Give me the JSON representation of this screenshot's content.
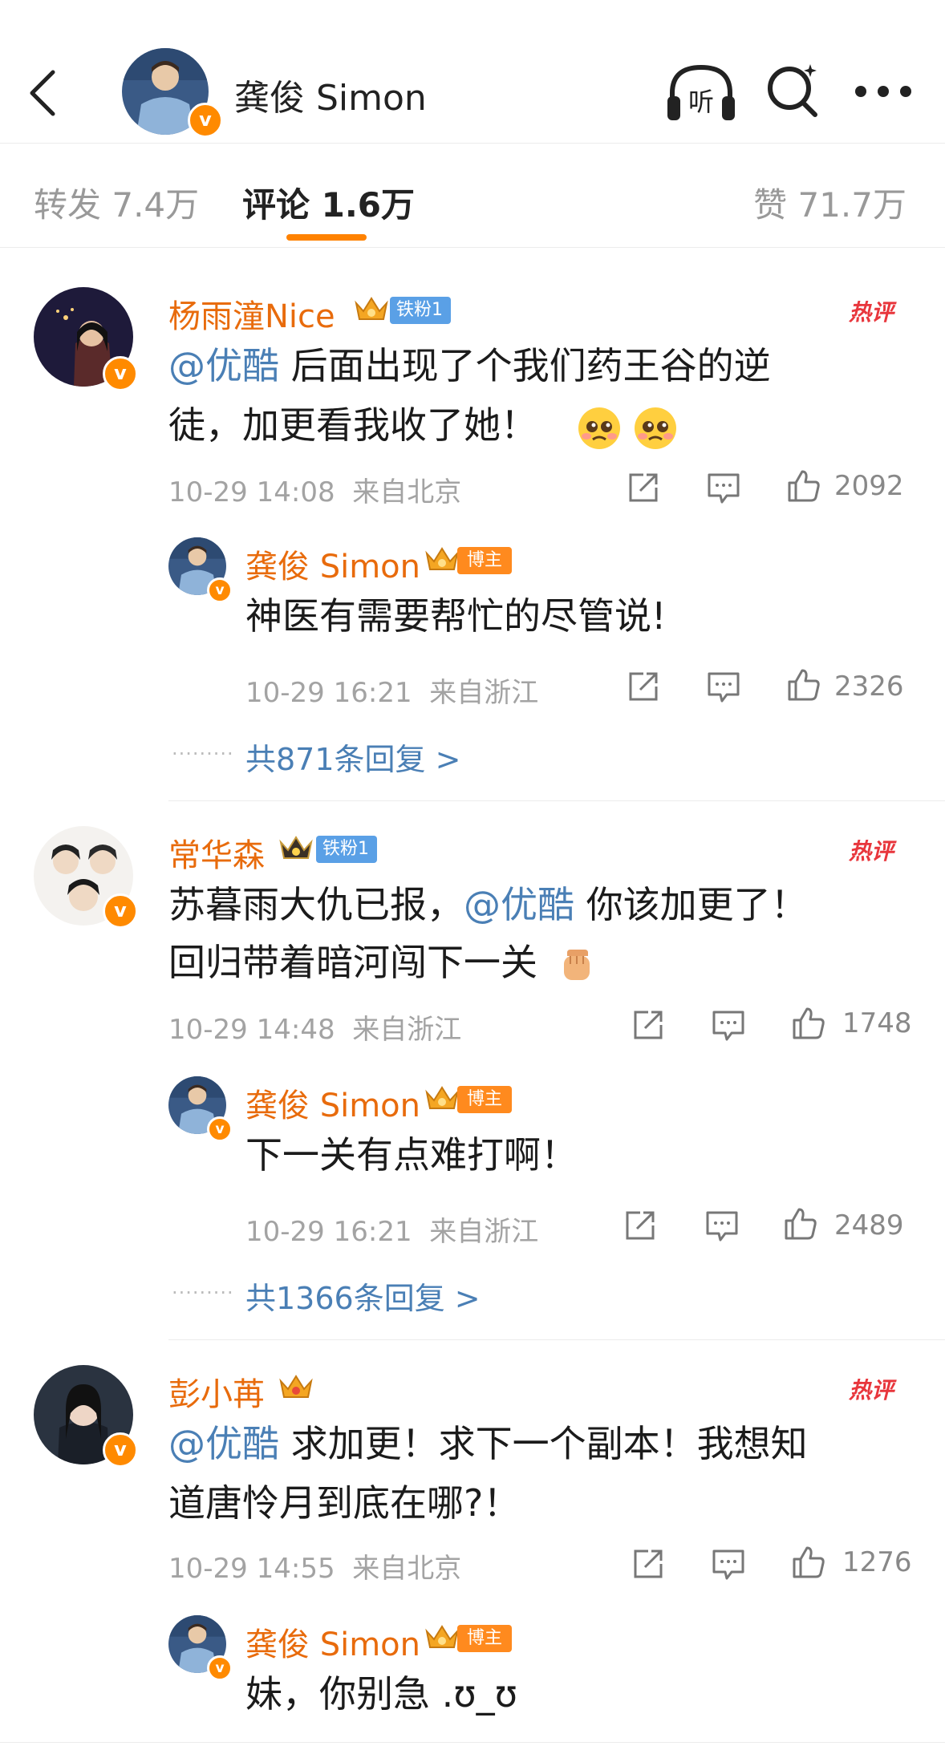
{
  "header": {
    "title": "龚俊 Simon",
    "listen_label": "听"
  },
  "tabs": {
    "repost": "转发 7.4万",
    "comment": "评论 1.6万",
    "like": "赞 71.7万"
  },
  "colors": {
    "accent": "#ff8200",
    "name": "#e86b0c",
    "link": "#4a7fb5",
    "hot": "#e8363c",
    "fan_badge": "#5aa0e6",
    "host_badge": "#ff8a1e"
  },
  "comments": [
    {
      "name": "杨雨潼Nice",
      "fan_badge": "铁粉1",
      "hot": "热评",
      "mention": "@优酷",
      "line1_rest": " 后面出现了个我们药王谷的逆",
      "line2": "徒，加更看我收了她！",
      "time": "10-29 14:08",
      "location": "来自北京",
      "likes": "2092",
      "reply": {
        "name": "龚俊 Simon",
        "badge": "博主",
        "text": "神医有需要帮忙的尽管说!",
        "time": "10-29 16:21",
        "location": "来自浙江",
        "likes": "2326"
      },
      "more_replies": "共871条回复 >"
    },
    {
      "name": "常华森",
      "fan_badge": "铁粉1",
      "hot": "热评",
      "line1_pre": "苏暮雨大仇已报，",
      "mention": "@优酷",
      "line1_post": " 你该加更了！",
      "line2": "回归带着暗河闯下一关",
      "time": "10-29 14:48",
      "location": "来自浙江",
      "likes": "1748",
      "reply": {
        "name": "龚俊 Simon",
        "badge": "博主",
        "text": "下一关有点难打啊！",
        "time": "10-29 16:21",
        "location": "来自浙江",
        "likes": "2489"
      },
      "more_replies": "共1366条回复 >"
    },
    {
      "name": "彭小苒",
      "hot": "热评",
      "mention": "@优酷",
      "line1_rest": " 求加更！求下一个副本！我想知",
      "line2": "道唐怜月到底在哪?！",
      "time": "10-29 14:55",
      "location": "来自北京",
      "likes": "1276",
      "reply": {
        "name": "龚俊 Simon",
        "badge": "博主",
        "text": "妹，你别急 .ʊ_ʊ"
      }
    }
  ]
}
